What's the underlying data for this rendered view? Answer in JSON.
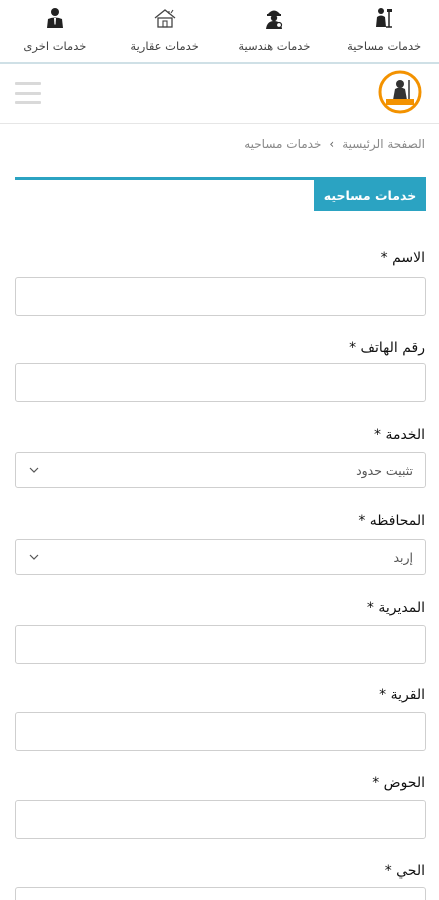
{
  "services_bar": {
    "items": [
      {
        "label": "خدمات مساحية",
        "icon": "surveyor-icon"
      },
      {
        "label": "خدمات هندسية",
        "icon": "engineer-icon"
      },
      {
        "label": "خدمات عقارية",
        "icon": "house-icon"
      },
      {
        "label": "خدمات اخرى",
        "icon": "business-person-icon"
      }
    ]
  },
  "header": {
    "logo_icon": "logo-icon",
    "menu_icon": "hamburger-menu-icon"
  },
  "breadcrumb": {
    "home": "الصفحة الرئيسية",
    "current": "خدمات مساحيه",
    "separator": "›"
  },
  "section": {
    "title": "خدمات مساحيه"
  },
  "form": {
    "name_label": "الاسم *",
    "phone_label": "رقم الهاتف *",
    "service_label": "الخدمة *",
    "service_value": "تثبيت حدود",
    "governorate_label": "المحافظه *",
    "governorate_value": "إربد",
    "directorate_label": "المديرية *",
    "village_label": "القرية *",
    "basin_label": "الحوض *",
    "district_label": "الحي *"
  },
  "colors": {
    "accent": "#2ba3c2",
    "border": "#cfcfcf",
    "logo_orange": "#f39200"
  }
}
